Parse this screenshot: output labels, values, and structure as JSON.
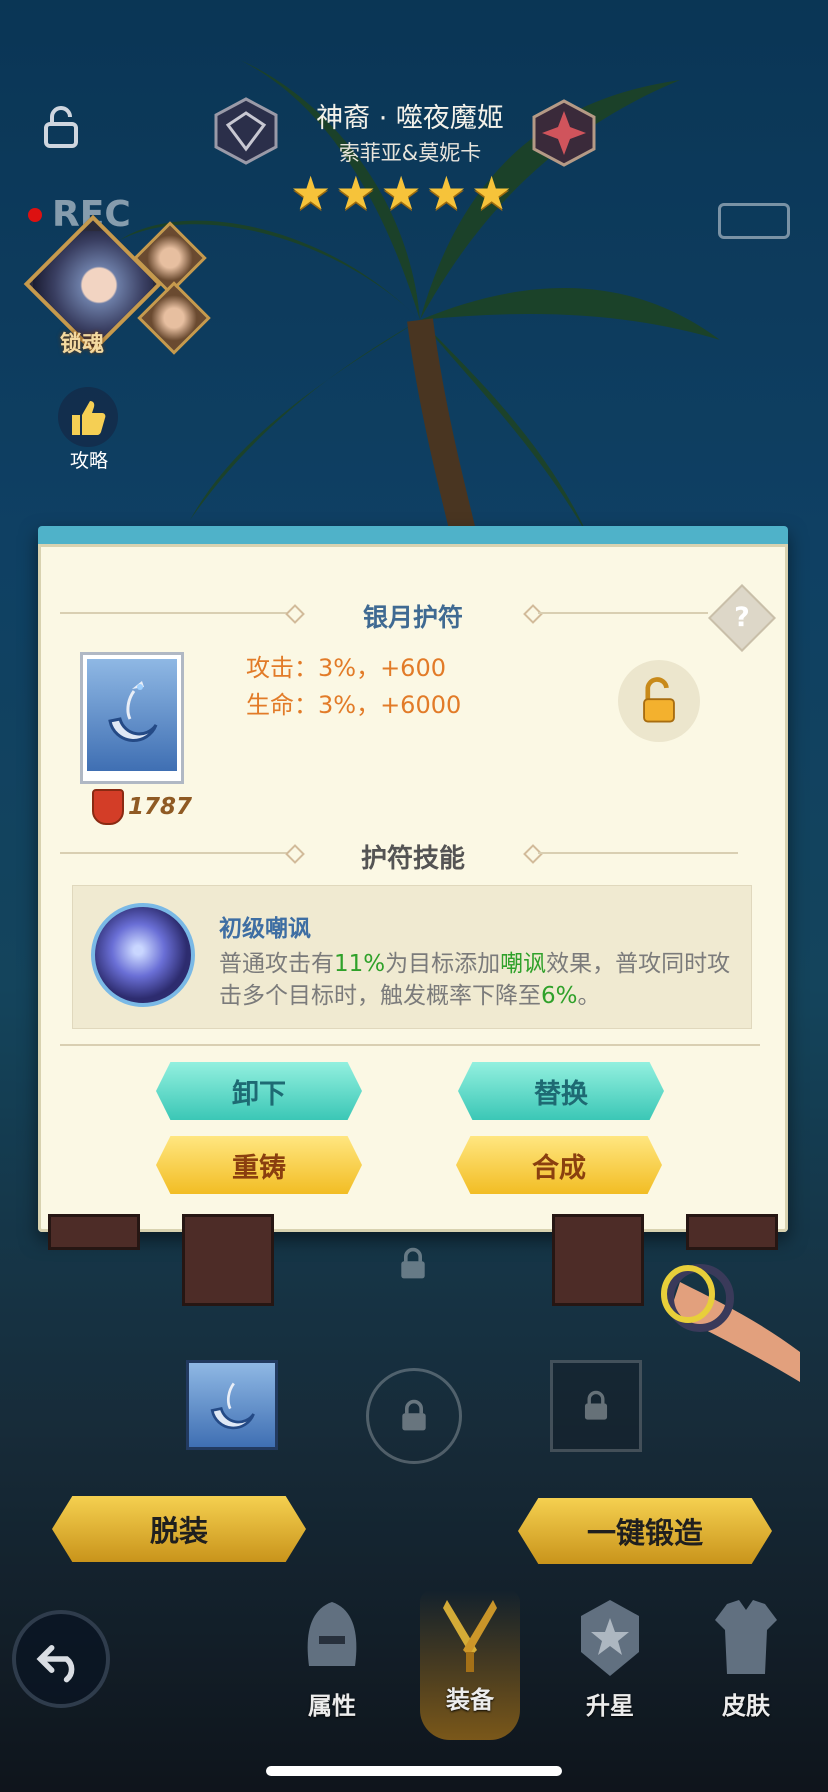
{
  "header": {
    "hero_title": "神裔 · 噬夜魔姬",
    "hero_subtitle": "索菲亚&莫妮卡",
    "star_count": 5,
    "rec_label": "REC",
    "lock_soul_label": "锁魂",
    "guide_label": "攻略"
  },
  "dialog": {
    "item_name": "银月护符",
    "stats": [
      "攻击：3%，+600",
      "生命：3%，+6000"
    ],
    "power": "1787",
    "help_glyph": "?",
    "skill_section_title": "护符技能",
    "skill": {
      "name": "初级嘲讽",
      "desc_parts": [
        "普通攻击有",
        "11%",
        "为目标添加",
        "嘲讽",
        "效果，普攻同时攻击多个目标时，触发概率下降至",
        "6%",
        "。"
      ]
    },
    "buttons": {
      "unequip": "卸下",
      "replace": "替换",
      "recast": "重铸",
      "combine": "合成"
    }
  },
  "board": {
    "strip_label": "脱装",
    "forge_label": "一键锻造"
  },
  "tabs": [
    {
      "label": "属性",
      "icon": "helmet-icon"
    },
    {
      "label": "装备",
      "icon": "weapons-icon",
      "active": true
    },
    {
      "label": "升星",
      "icon": "star-badge-icon"
    },
    {
      "label": "皮肤",
      "icon": "armor-icon"
    }
  ],
  "colors": {
    "panel_bg": "#fbf8e4",
    "panel_top": "#4fb2c9",
    "title_blue": "#3f6a92",
    "stat_orange": "#e27b28",
    "highlight_green": "#2fa12a",
    "button_teal": "#3bc7b6",
    "button_gold": "#f2bd24"
  }
}
